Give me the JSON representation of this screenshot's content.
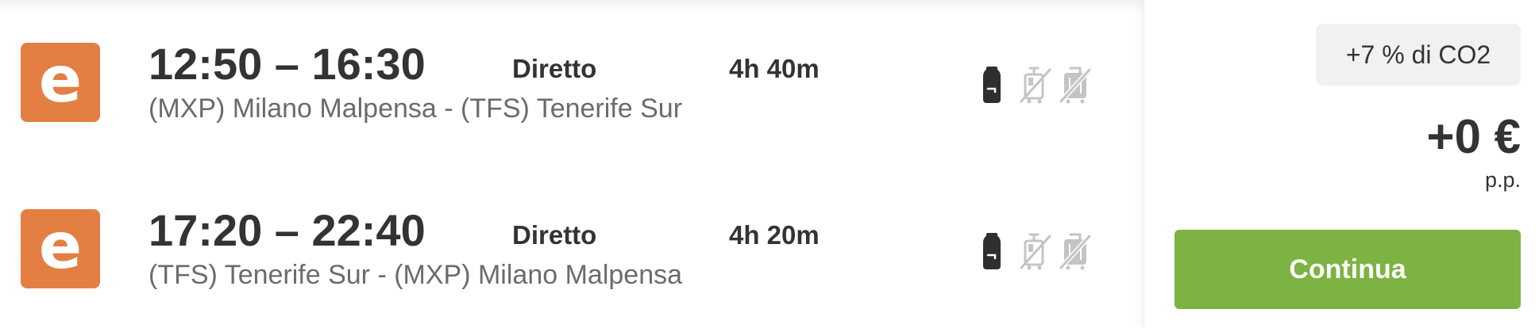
{
  "flights": [
    {
      "airline_logo_letter": "e",
      "times": "12:50 – 16:30",
      "route": "(MXP) Milano Malpensa - (TFS) Tenerife Sur",
      "stops": "Diretto",
      "duration": "4h 40m",
      "baggage": [
        {
          "icon": "backpack-icon",
          "included": true
        },
        {
          "icon": "cabin-trolley-crossed-icon",
          "included": false
        },
        {
          "icon": "checked-bag-crossed-icon",
          "included": false
        }
      ]
    },
    {
      "airline_logo_letter": "e",
      "times": "17:20 – 22:40",
      "route": "(TFS) Tenerife Sur - (MXP) Milano Malpensa",
      "stops": "Diretto",
      "duration": "4h 20m",
      "baggage": [
        {
          "icon": "backpack-icon",
          "included": true
        },
        {
          "icon": "cabin-trolley-crossed-icon",
          "included": false
        },
        {
          "icon": "checked-bag-crossed-icon",
          "included": false
        }
      ]
    }
  ],
  "pricing": {
    "co2_badge": "+7 % di CO2",
    "price": "+0 €",
    "per_person": "p.p.",
    "continue_label": "Continua"
  },
  "colors": {
    "airline_logo": "#e37f43",
    "continue_button": "#7cb342",
    "co2_badge_bg": "#f1f1f1",
    "icon_included": "#2f2f2f",
    "icon_excluded": "#c4c4c4"
  }
}
